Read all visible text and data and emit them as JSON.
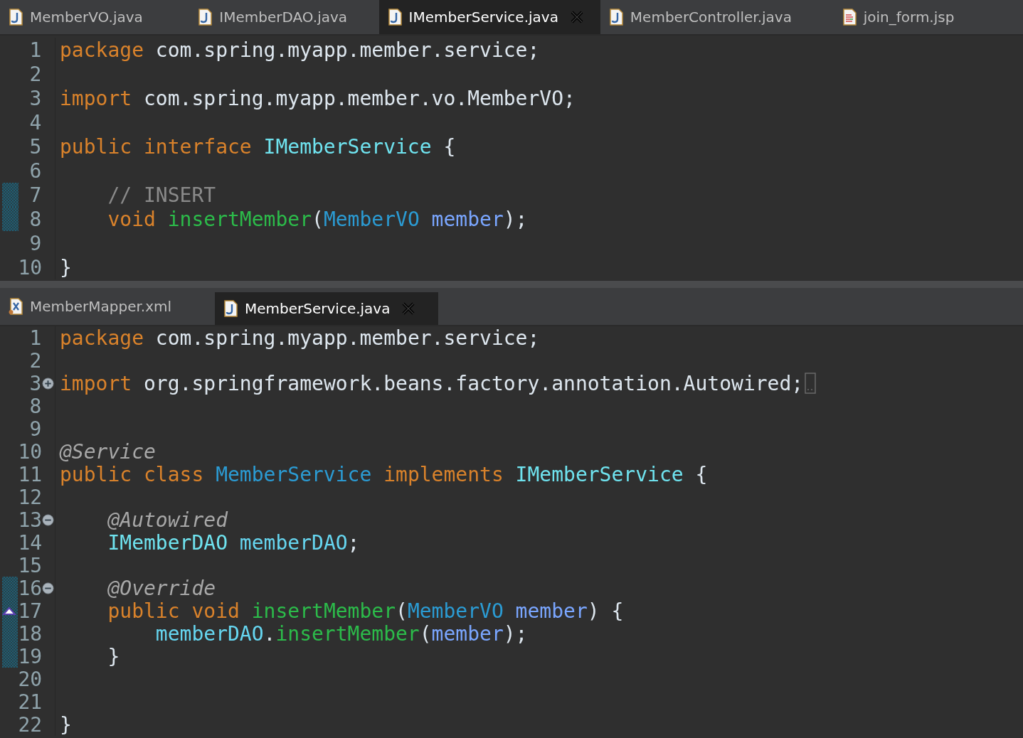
{
  "editors": [
    {
      "tabs": [
        {
          "label": "MemberVO.java",
          "kind": "java",
          "selected": false
        },
        {
          "label": "IMemberDAO.java",
          "kind": "java",
          "selected": false
        },
        {
          "label": "IMemberService.java",
          "kind": "java",
          "selected": true
        },
        {
          "label": "MemberController.java",
          "kind": "java",
          "selected": false
        },
        {
          "label": "join_form.jsp",
          "kind": "jsp",
          "selected": false
        }
      ],
      "lines": [
        {
          "number": "1",
          "changed": false,
          "override": false,
          "tokens": [
            {
              "text": "package",
              "kind": "keyword"
            },
            {
              "text": " com.spring.myapp.member.service;",
              "kind": "plain"
            }
          ]
        },
        {
          "number": "2",
          "changed": false,
          "override": false
        },
        {
          "number": "3",
          "changed": false,
          "override": false,
          "tokens": [
            {
              "text": "import",
              "kind": "keyword"
            },
            {
              "text": " com.spring.myapp.member.vo.MemberVO;",
              "kind": "plain"
            }
          ]
        },
        {
          "number": "4",
          "changed": false,
          "override": false
        },
        {
          "number": "5",
          "changed": false,
          "override": false,
          "tokens": [
            {
              "text": "public interface",
              "kind": "keyword"
            },
            {
              "text": " IMemberService",
              "kind": "interface"
            },
            {
              "text": " {",
              "kind": "plain"
            }
          ]
        },
        {
          "number": "6",
          "changed": false,
          "override": false
        },
        {
          "number": "7",
          "changed": true,
          "override": false,
          "tokens": [
            {
              "text": "    // INSERT",
              "kind": "comment"
            }
          ]
        },
        {
          "number": "8",
          "changed": true,
          "override": false,
          "tokens": [
            {
              "text": "    void",
              "kind": "keyword"
            },
            {
              "text": " insertMember",
              "kind": "method"
            },
            {
              "text": "(",
              "kind": "plain"
            },
            {
              "text": "MemberVO",
              "kind": "class"
            },
            {
              "text": " member",
              "kind": "param"
            },
            {
              "text": ");",
              "kind": "plain"
            }
          ]
        },
        {
          "number": "9",
          "changed": false,
          "override": false
        },
        {
          "number": "10",
          "changed": false,
          "override": false,
          "tokens": [
            {
              "text": "}",
              "kind": "plain"
            }
          ]
        }
      ]
    },
    {
      "tabs": [
        {
          "label": "MemberMapper.xml",
          "kind": "xml",
          "selected": false
        },
        {
          "label": "MemberService.java",
          "kind": "java",
          "selected": true
        }
      ],
      "lines": [
        {
          "number": "1",
          "changed": false,
          "override": false,
          "tokens": [
            {
              "text": "package",
              "kind": "keyword"
            },
            {
              "text": " com.spring.myapp.member.service;",
              "kind": "plain"
            }
          ]
        },
        {
          "number": "2",
          "changed": false,
          "override": false
        },
        {
          "number": "3",
          "collapsed": true,
          "changed": false,
          "override": false,
          "tokens": [
            {
              "text": "import",
              "kind": "keyword"
            },
            {
              "text": " org.springframework.beans.factory.annotation.Autowired;",
              "kind": "plain"
            }
          ]
        },
        {
          "number": "8",
          "changed": false,
          "override": false
        },
        {
          "number": "9",
          "changed": false,
          "override": false
        },
        {
          "number": "10",
          "changed": false,
          "override": false,
          "tokens": [
            {
              "text": "@Service",
              "kind": "annotation"
            }
          ]
        },
        {
          "number": "11",
          "changed": false,
          "override": false,
          "tokens": [
            {
              "text": "public class",
              "kind": "keyword"
            },
            {
              "text": " MemberService",
              "kind": "class"
            },
            {
              "text": " implements",
              "kind": "keyword"
            },
            {
              "text": " IMemberService",
              "kind": "interface"
            },
            {
              "text": " {",
              "kind": "plain"
            }
          ]
        },
        {
          "number": "12",
          "changed": false,
          "override": false
        },
        {
          "number": "13",
          "collapsed": false,
          "changed": false,
          "override": false,
          "tokens": [
            {
              "text": "    @Autowired",
              "kind": "annotation"
            }
          ]
        },
        {
          "number": "14",
          "changed": false,
          "override": false,
          "tokens": [
            {
              "text": "    IMemberDAO",
              "kind": "interface"
            },
            {
              "text": " memberDAO",
              "kind": "field"
            },
            {
              "text": ";",
              "kind": "plain"
            }
          ]
        },
        {
          "number": "15",
          "changed": false,
          "override": false
        },
        {
          "number": "16",
          "collapsed": false,
          "changed": true,
          "override": false,
          "tokens": [
            {
              "text": "    @Override",
              "kind": "annotation"
            }
          ]
        },
        {
          "number": "17",
          "changed": true,
          "override": true,
          "tokens": [
            {
              "text": "    public void",
              "kind": "keyword"
            },
            {
              "text": " insertMember",
              "kind": "method"
            },
            {
              "text": "(",
              "kind": "plain"
            },
            {
              "text": "MemberVO",
              "kind": "class"
            },
            {
              "text": " member",
              "kind": "param"
            },
            {
              "text": ") {",
              "kind": "plain"
            }
          ]
        },
        {
          "number": "18",
          "changed": true,
          "override": false,
          "tokens": [
            {
              "text": "        memberDAO",
              "kind": "field"
            },
            {
              "text": ".",
              "kind": "plain"
            },
            {
              "text": "insertMember",
              "kind": "method"
            },
            {
              "text": "(",
              "kind": "plain"
            },
            {
              "text": "member",
              "kind": "param"
            },
            {
              "text": ");",
              "kind": "plain"
            }
          ]
        },
        {
          "number": "19",
          "changed": true,
          "override": false,
          "tokens": [
            {
              "text": "    }",
              "kind": "plain"
            }
          ]
        },
        {
          "number": "20",
          "changed": false,
          "override": false
        },
        {
          "number": "21",
          "changed": false,
          "override": false
        },
        {
          "number": "22",
          "changed": false,
          "override": false,
          "tokens": [
            {
              "text": "}",
              "kind": "plain"
            }
          ]
        }
      ]
    }
  ]
}
